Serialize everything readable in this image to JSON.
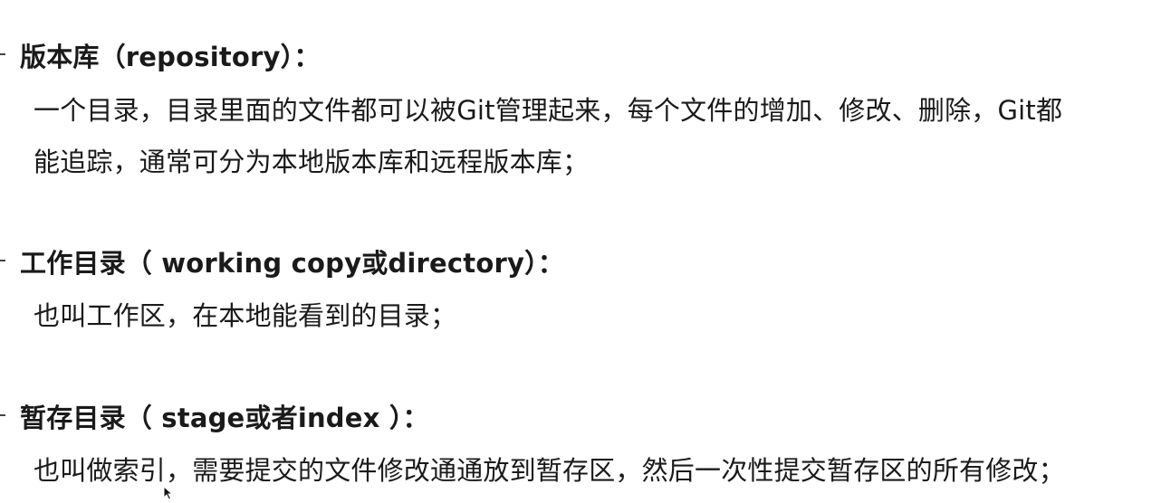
{
  "sections": [
    {
      "heading": "版本库（repository）：",
      "lines": [
        "一个目录，目录里面的文件都可以被Git管理起来，每个文件的增加、修改、删除，Git都",
        "能追踪，通常可分为本地版本库和远程版本库；"
      ]
    },
    {
      "heading": "工作目录（ working copy或directory）：",
      "lines": [
        "也叫工作区，在本地能看到的目录；"
      ]
    },
    {
      "heading": "暂存目录（ stage或者index ）：",
      "lines": [
        "也叫做索引，需要提交的文件修改通通放到暂存区，然后一次性提交暂存区的所有修改；"
      ]
    }
  ],
  "cursor_icon": "arrow-pointer-icon"
}
